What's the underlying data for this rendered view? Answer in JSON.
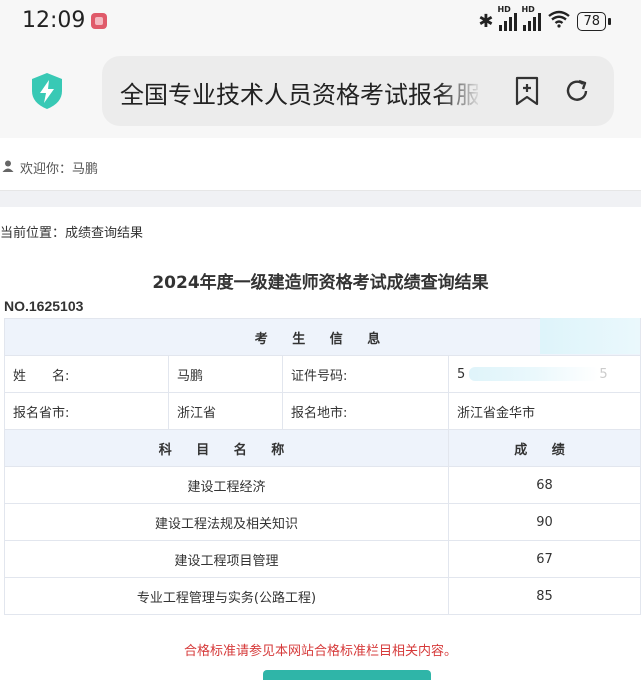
{
  "status_bar": {
    "time": "12:09",
    "battery": "78",
    "network_label": "HD",
    "icons": [
      "app-notification-icon",
      "bluetooth-icon",
      "signal-icon",
      "wifi-icon",
      "battery-icon"
    ]
  },
  "browser": {
    "url_text": "全国专业技术人员资格考试报名服",
    "icons": [
      "shield-bolt-icon",
      "bookmark-add-icon",
      "reload-icon"
    ],
    "accent": "#38c9b5"
  },
  "header": {
    "welcome": "欢迎你：马鹏"
  },
  "breadcrumb": "当前位置：成绩查询结果",
  "result": {
    "title": "2024年度一级建造师资格考试成绩查询结果",
    "number": "NO.1625103",
    "candidate_section_title": "考 生 信 息",
    "fields": {
      "name_label": "姓　　名:",
      "name_value": "马鹏",
      "id_label": "证件号码:",
      "id_value_visible": "5",
      "id_value_tail": "5",
      "province_label": "报名省市:",
      "province_value": "浙江省",
      "location_label": "报名地市:",
      "location_value": "浙江省金华市"
    },
    "subjects_header": "科 目 名 称",
    "score_header": "成 绩",
    "subjects": [
      {
        "name": "建设工程经济",
        "score": "68"
      },
      {
        "name": "建设工程法规及相关知识",
        "score": "90"
      },
      {
        "name": "建设工程项目管理",
        "score": "67"
      },
      {
        "name": "专业工程管理与实务(公路工程)",
        "score": "85"
      }
    ],
    "note": "合格标准请参见本网站合格标准栏目相关内容。"
  },
  "colors": {
    "note_red": "#d63a3a",
    "header_bg": "#eef3fb",
    "button_teal": "#2fb5a8"
  }
}
